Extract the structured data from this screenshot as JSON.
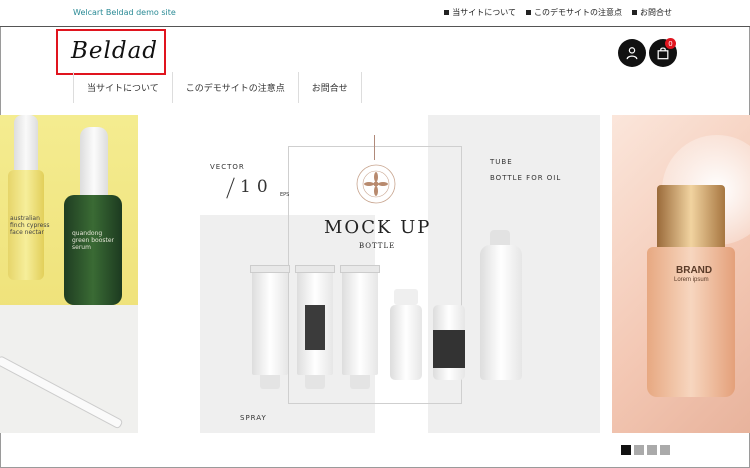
{
  "header": {
    "site_tag": "Welcart Beldad demo site",
    "logo_text": "Beldad",
    "util_links": [
      "当サイトについて",
      "このデモサイトの注意点",
      "お問合せ"
    ],
    "cart_count": "0"
  },
  "nav": {
    "items": [
      "当サイトについて",
      "このデモサイトの注意点",
      "お問合せ"
    ]
  },
  "hero": {
    "left_slide": {
      "bottle_left_text": "australian\nfinch cypress\nface nectar",
      "bottle_right_text": "quandong\ngreen booster\nserum"
    },
    "center_slide": {
      "vector": "VECTOR",
      "ten": "10",
      "eps": "EPS",
      "tube": "TUBE",
      "bottle_for_oil": "BOTTLE FOR OIL",
      "mock_up": "MOCK UP",
      "bottle": "BOTTLE",
      "spray": "SPRAY"
    },
    "right_slide": {
      "brand": "BRAND",
      "lorem": "Lorem ipsum"
    }
  },
  "pagination": {
    "total": 4,
    "active": 0
  },
  "colors": {
    "accent_red": "#e0141e",
    "site_tag": "#2a8a95",
    "icon_bg": "#111111"
  }
}
